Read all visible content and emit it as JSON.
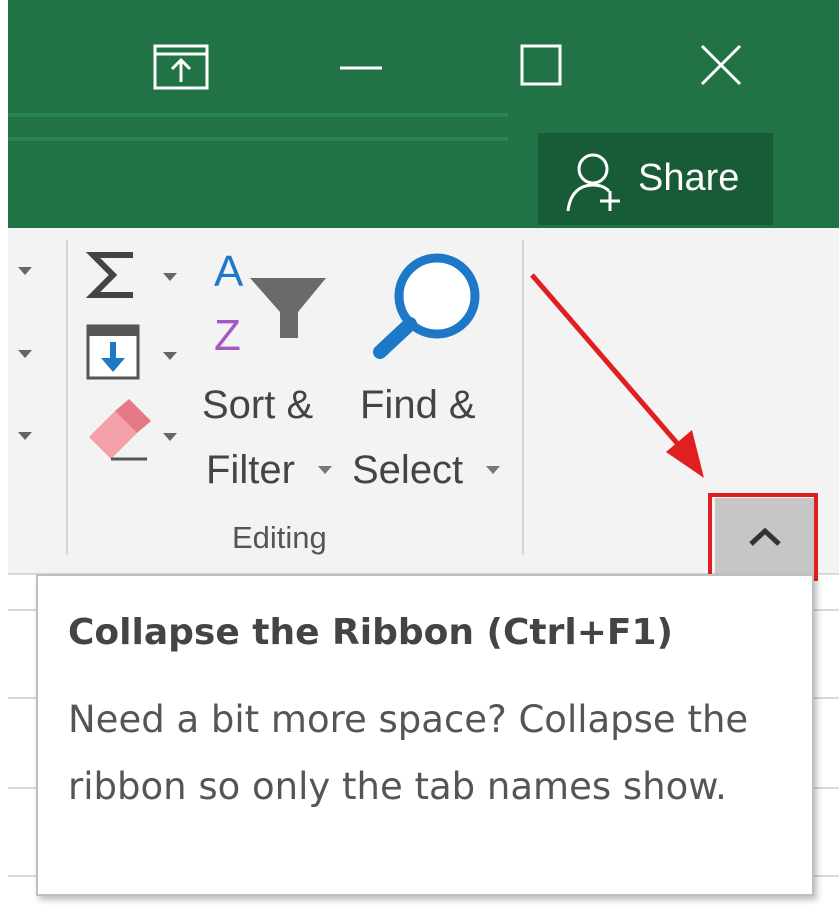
{
  "header": {
    "share_label": "Share"
  },
  "icons": {
    "restore": "ribbon-display-options-icon",
    "minimize": "minimize-icon",
    "maximize": "maximize-icon",
    "close": "close-icon",
    "share": "add-person-icon",
    "autosum": "sigma-icon",
    "fill": "fill-down-icon",
    "clear": "eraser-icon",
    "sort": "sort-az-filter-icon",
    "find": "magnifier-icon",
    "collapse": "chevron-up-icon"
  },
  "ribbon": {
    "editing": {
      "sort_filter_line1": "Sort &",
      "sort_filter_line2": "Filter",
      "find_select_line1": "Find &",
      "find_select_line2": "Select",
      "group_label": "Editing"
    }
  },
  "tooltip": {
    "title": "Collapse the Ribbon (Ctrl+F1)",
    "body": "Need a bit more space? Collapse the ribbon so only the tab names show."
  },
  "colors": {
    "titlebar": "#217346",
    "share_button": "#185c37",
    "highlight": "#e02020"
  }
}
